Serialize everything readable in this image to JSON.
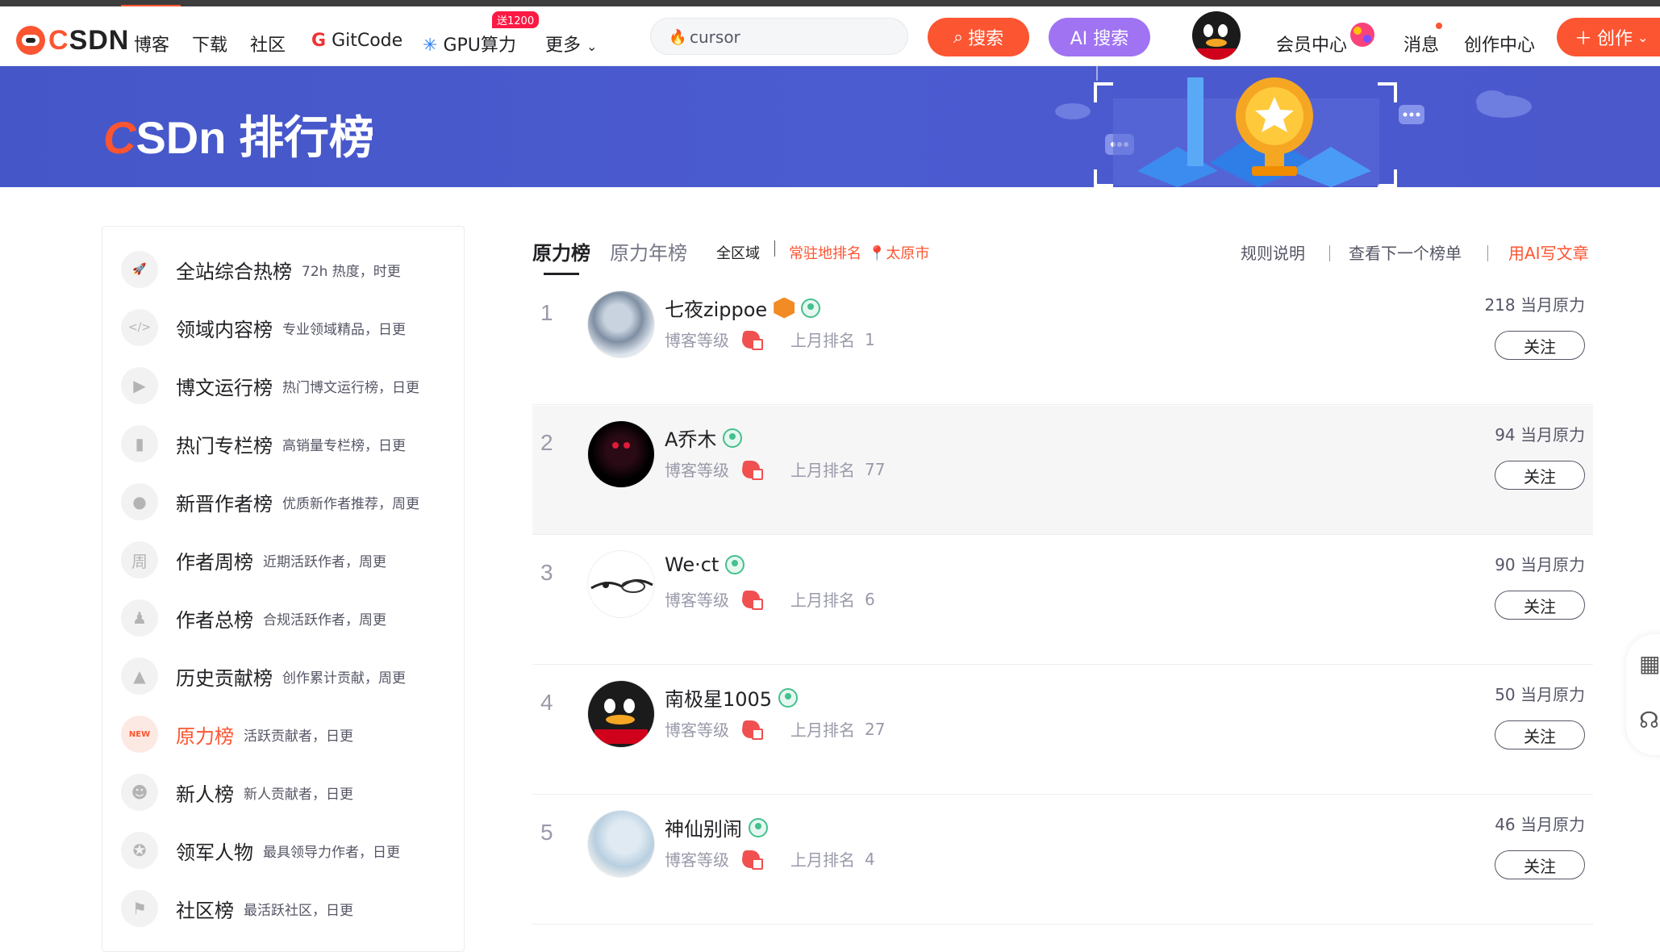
{
  "header": {
    "logo_text_c": "C",
    "logo_text_rest": "SDN",
    "nav": [
      {
        "label": "博客"
      },
      {
        "label": "下载"
      },
      {
        "label": "社区"
      },
      {
        "label": "GitCode"
      },
      {
        "label": "GPU算力"
      },
      {
        "label": "更多"
      }
    ],
    "gpu_badge": "送1200",
    "search_value": "cursor",
    "search_button": "搜索",
    "ai_search_button": "AI 搜索",
    "right_links": [
      {
        "label": "会员中心"
      },
      {
        "label": "消息"
      },
      {
        "label": "创作中心"
      }
    ],
    "create_button": "创作"
  },
  "banner": {
    "title_rest": "SDn 排行榜",
    "title_c": "C"
  },
  "sidebar": {
    "items": [
      {
        "label": "全站综合热榜",
        "desc": "72h 热度，时更",
        "icon": "rocket-icon",
        "glyph": "🚀"
      },
      {
        "label": "领域内容榜",
        "desc": "专业领域精品，日更",
        "icon": "code-icon",
        "glyph": "</>"
      },
      {
        "label": "博文运行榜",
        "desc": "热门博文运行榜，日更",
        "icon": "play-icon",
        "glyph": "▶"
      },
      {
        "label": "热门专栏榜",
        "desc": "高销量专栏榜，日更",
        "icon": "book-icon",
        "glyph": "▮"
      },
      {
        "label": "新晋作者榜",
        "desc": "优质新作者推荐，周更",
        "icon": "user-icon",
        "glyph": "●"
      },
      {
        "label": "作者周榜",
        "desc": "近期活跃作者，周更",
        "icon": "week-icon",
        "glyph": "周"
      },
      {
        "label": "作者总榜",
        "desc": "合规活跃作者，周更",
        "icon": "users-icon",
        "glyph": "♟"
      },
      {
        "label": "历史贡献榜",
        "desc": "创作累计贡献，周更",
        "icon": "contribution-icon",
        "glyph": "▲"
      },
      {
        "label": "原力榜",
        "desc": "活跃贡献者，日更",
        "icon": "new-badge-icon",
        "glyph": "NEW",
        "active": true
      },
      {
        "label": "新人榜",
        "desc": "新人贡献者，日更",
        "icon": "newcomer-icon",
        "glyph": "☻"
      },
      {
        "label": "领军人物",
        "desc": "最具领导力作者，日更",
        "icon": "medal-icon",
        "glyph": "✪"
      },
      {
        "label": "社区榜",
        "desc": "最活跃社区，日更",
        "icon": "flag-icon",
        "glyph": "⚑"
      }
    ]
  },
  "tabs": {
    "active": "原力榜",
    "inactive": "原力年榜",
    "region_all": "全区域",
    "resident_rank": "常驻地排名",
    "city": "太原市"
  },
  "links": {
    "rules": "规则说明",
    "next_list": "查看下一个榜单",
    "ai_write": "用AI写文章"
  },
  "ranking": {
    "level_label": "博客等级",
    "last_month_label": "上月排名",
    "power_suffix": "当月原力",
    "follow_label": "关注",
    "rows": [
      {
        "rank": "1",
        "name": "七夜zippoe",
        "last_rank": "1",
        "power": "218",
        "has_orange_badge": true
      },
      {
        "rank": "2",
        "name": "A乔木",
        "last_rank": "77",
        "power": "94"
      },
      {
        "rank": "3",
        "name": "We·ct",
        "last_rank": "6",
        "power": "90"
      },
      {
        "rank": "4",
        "name": "南极星1005",
        "last_rank": "27",
        "power": "50"
      },
      {
        "rank": "5",
        "name": "神仙别闹",
        "last_rank": "4",
        "power": "46"
      }
    ]
  },
  "colors": {
    "accent": "#fc5531",
    "ai_purple": "#a073f3",
    "banner": "#4758cb",
    "badge_green": "#44c08c"
  }
}
